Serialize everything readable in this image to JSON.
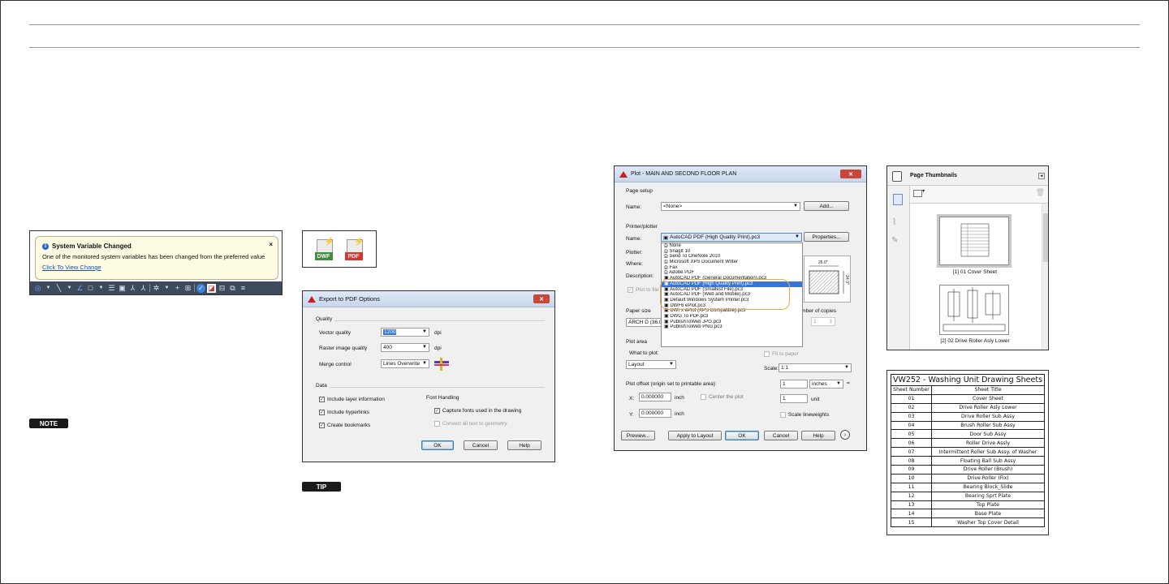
{
  "notification": {
    "title": "System Variable Changed",
    "message": "One of the monitored system variables has been changed from the preferred value",
    "link": "Click To View Change",
    "close": "×"
  },
  "badges": {
    "note": "NOTE",
    "tip": "TIP"
  },
  "file_icons": {
    "dwf": "DWF",
    "pdf": "PDF"
  },
  "export_pdf": {
    "title": "Export to PDF Options",
    "quality_group": "Quality",
    "vector_quality_label": "Vector quality",
    "vector_quality_value": "1200",
    "raster_quality_label": "Raster image quality",
    "raster_quality_value": "400",
    "dpi": "dpi",
    "merge_control_label": "Merge control",
    "merge_control_value": "Lines Overwrite",
    "data_group": "Data",
    "include_layer": "Include layer information",
    "include_hyperlinks": "Include hyperlinks",
    "create_bookmarks": "Create bookmarks",
    "font_handling": "Font Handling",
    "capture_fonts": "Capture fonts used in the drawing",
    "convert_text": "Convert all text to geometry",
    "ok": "OK",
    "cancel": "Cancel",
    "help": "Help"
  },
  "plot": {
    "title": "Plot - MAIN AND SECOND FLOOR PLAN",
    "page_setup": "Page setup",
    "name_label": "Name:",
    "page_setup_value": "<None>",
    "add": "Add...",
    "printer_plotter": "Printer/plotter",
    "printer_value": "AutoCAD PDF (High Quality Print).pc3",
    "properties": "Properties...",
    "plotter_label": "Plotter:",
    "where_label": "Where:",
    "description_label": "Description:",
    "plot_to_file": "Plot to file",
    "paper_size": "Paper size",
    "paper_value": "ARCH D (36.0",
    "number_of_copies": "Number of copies",
    "copies_value": "1",
    "plot_area": "Plot area",
    "what_to_plot": "What to plot:",
    "what_value": "Layout",
    "fit_to_paper": "Fit to paper",
    "scale_label": "Scale:",
    "scale_value": "1:1",
    "scale_num": "1",
    "scale_unit": "inches",
    "scale_den": "1",
    "unit_label": "unit",
    "scale_lineweights": "Scale lineweights",
    "plot_offset": "Plot offset (origin set to printable area)",
    "x_label": "X:",
    "x_value": "0.000000",
    "y_label": "Y:",
    "y_value": "0.000000",
    "inch": "inch",
    "center_plot": "Center the plot",
    "preview": "Preview...",
    "apply_layout": "Apply to Layout",
    "ok": "OK",
    "cancel": "Cancel",
    "help": "Help",
    "dim_label": "26.0\"",
    "dim_label_v": "24.0\"",
    "printers": [
      "None",
      "SnagIt 10",
      "Send To OneNote 2010",
      "Microsoft XPS Document Writer",
      "Fax",
      "Adobe PDF",
      "AutoCAD PDF (General Documentation).pc3",
      "AutoCAD PDF (High Quality Print).pc3",
      "AutoCAD PDF (Smallest File).pc3",
      "AutoCAD PDF (Web and Mobile).pc3",
      "Default Windows System Printer.pc3",
      "DWF6 ePlot.pc3",
      "DWFx ePlot (XPS Compatible).pc3",
      "DWG To PDF.pc3",
      "PublishToWeb JPG.pc3",
      "PublishToWeb PNG.pc3"
    ],
    "selected_index": 7
  },
  "thumbnails": {
    "title": "Page Thumbnails",
    "pages": [
      "[1] 01 Cover Sheet",
      "[2] 02 Drive Roller Asly Lower"
    ]
  },
  "sheet_table": {
    "title": "VW252 - Washing Unit Drawing Sheets",
    "headers": [
      "Sheet Number",
      "Sheet Title"
    ],
    "rows": [
      [
        "01",
        "Cover Sheet"
      ],
      [
        "02",
        "Drive Roller Asly Lower"
      ],
      [
        "03",
        "Drive Roller Sub Assy"
      ],
      [
        "04",
        "Brush Roller Sub Assy"
      ],
      [
        "05",
        "Door Sub Assy"
      ],
      [
        "06",
        "Roller Drive Assly"
      ],
      [
        "07",
        "Intermittent Roller Sub Assy. of Washer"
      ],
      [
        "08",
        "Floating Ball Sub Assy"
      ],
      [
        "09",
        "Drive Roller (Brush)"
      ],
      [
        "10",
        "Drive Roller (Fix)"
      ],
      [
        "11",
        "Bearing Block_Slide"
      ],
      [
        "12",
        "Bearing Sprt Plate"
      ],
      [
        "13",
        "Top Plate"
      ],
      [
        "14",
        "Base Plate"
      ],
      [
        "15",
        "Washer Top Cover Detail"
      ]
    ]
  },
  "colors": {
    "accent_blue": "#2a62c9",
    "selection": "#3875d7",
    "highlight_ring": "#e4a94b",
    "autocad_red": "#cc1f1f",
    "pdf_red": "#d9342b",
    "dwf_green": "#3e8e3a"
  }
}
